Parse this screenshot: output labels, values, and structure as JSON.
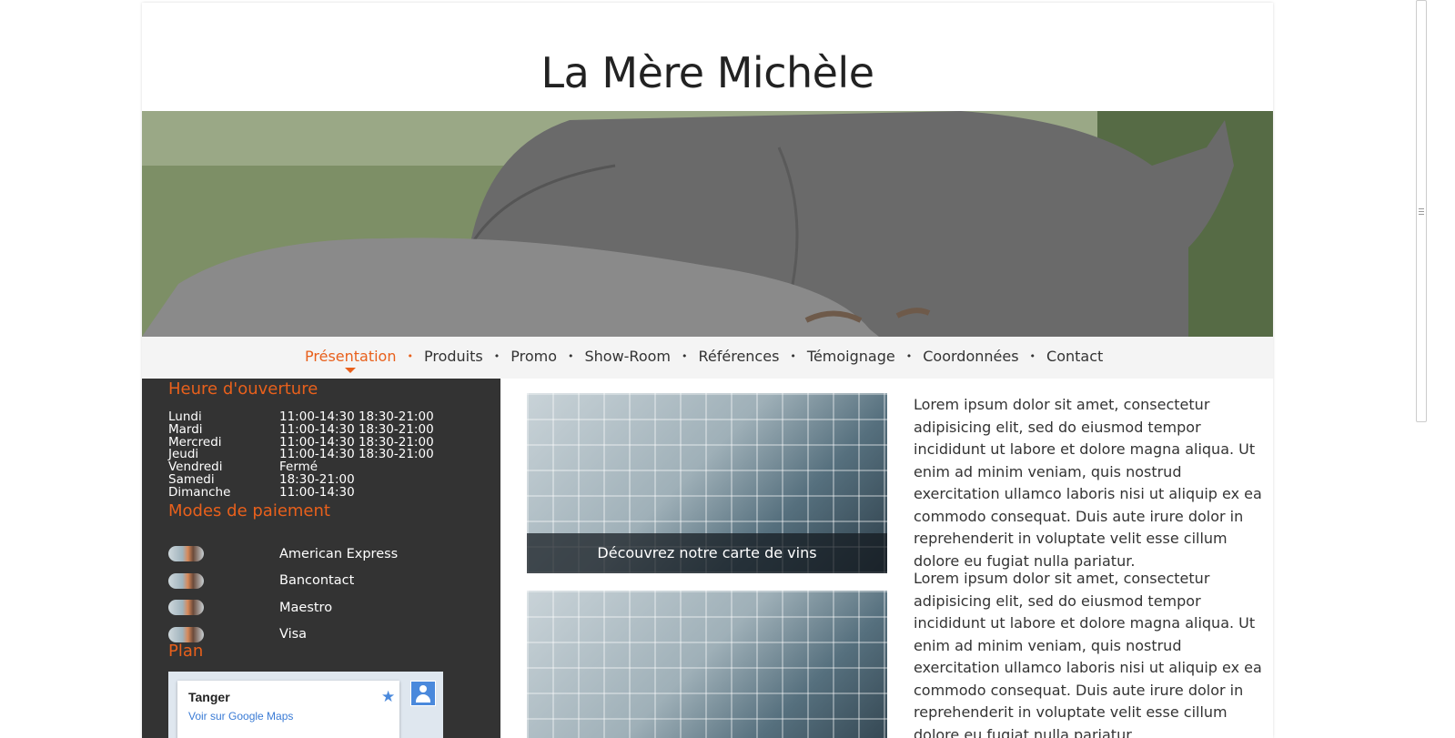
{
  "site": {
    "title": "La Mère Michèle"
  },
  "nav": {
    "items": [
      {
        "label": "Présentation",
        "active": true
      },
      {
        "label": "Produits"
      },
      {
        "label": "Promo"
      },
      {
        "label": "Show-Room"
      },
      {
        "label": "Références"
      },
      {
        "label": "Témoignage"
      },
      {
        "label": "Coordonnées"
      },
      {
        "label": "Contact"
      }
    ],
    "separator": "•"
  },
  "sidebar": {
    "hours_title": "Heure d'ouverture",
    "hours": [
      {
        "day": "Lundi",
        "time": "11:00-14:30 18:30-21:00"
      },
      {
        "day": "Mardi",
        "time": "11:00-14:30 18:30-21:00"
      },
      {
        "day": "Mercredi",
        "time": "11:00-14:30 18:30-21:00"
      },
      {
        "day": "Jeudi",
        "time": "11:00-14:30 18:30-21:00"
      },
      {
        "day": "Vendredi",
        "time": "Fermé"
      },
      {
        "day": "Samedi",
        "time": "18:30-21:00"
      },
      {
        "day": "Dimanche",
        "time": "11:00-14:30"
      }
    ],
    "payment_title": "Modes de paiement",
    "payments": [
      "American Express",
      "Bancontact",
      "Maestro",
      "Visa"
    ],
    "plan_title": "Plan",
    "map": {
      "city": "Tanger",
      "link": "Voir sur Google Maps"
    }
  },
  "content": {
    "cards": [
      {
        "caption": "Découvrez notre carte de vins"
      },
      {
        "caption": ""
      }
    ],
    "paragraphs": [
      "Lorem ipsum dolor sit amet, consectetur adipisicing elit, sed do eiusmod tempor incididunt ut labore et dolore magna aliqua. Ut enim ad minim veniam, quis nostrud exercitation ullamco laboris nisi ut aliquip ex ea commodo consequat. Duis aute irure dolor in reprehenderit in voluptate velit esse cillum dolore eu fugiat nulla pariatur.",
      "Lorem ipsum dolor sit amet, consectetur adipisicing elit, sed do eiusmod tempor incididunt ut labore et dolore magna aliqua. Ut enim ad minim veniam, quis nostrud exercitation ullamco laboris nisi ut aliquip ex ea commodo consequat. Duis aute irure dolor in reprehenderit in voluptate velit esse cillum dolore eu fugiat nulla pariatur."
    ]
  },
  "colors": {
    "accent": "#e8601c",
    "sidebar_bg": "#333333",
    "nav_bg": "#f4f4f4"
  }
}
